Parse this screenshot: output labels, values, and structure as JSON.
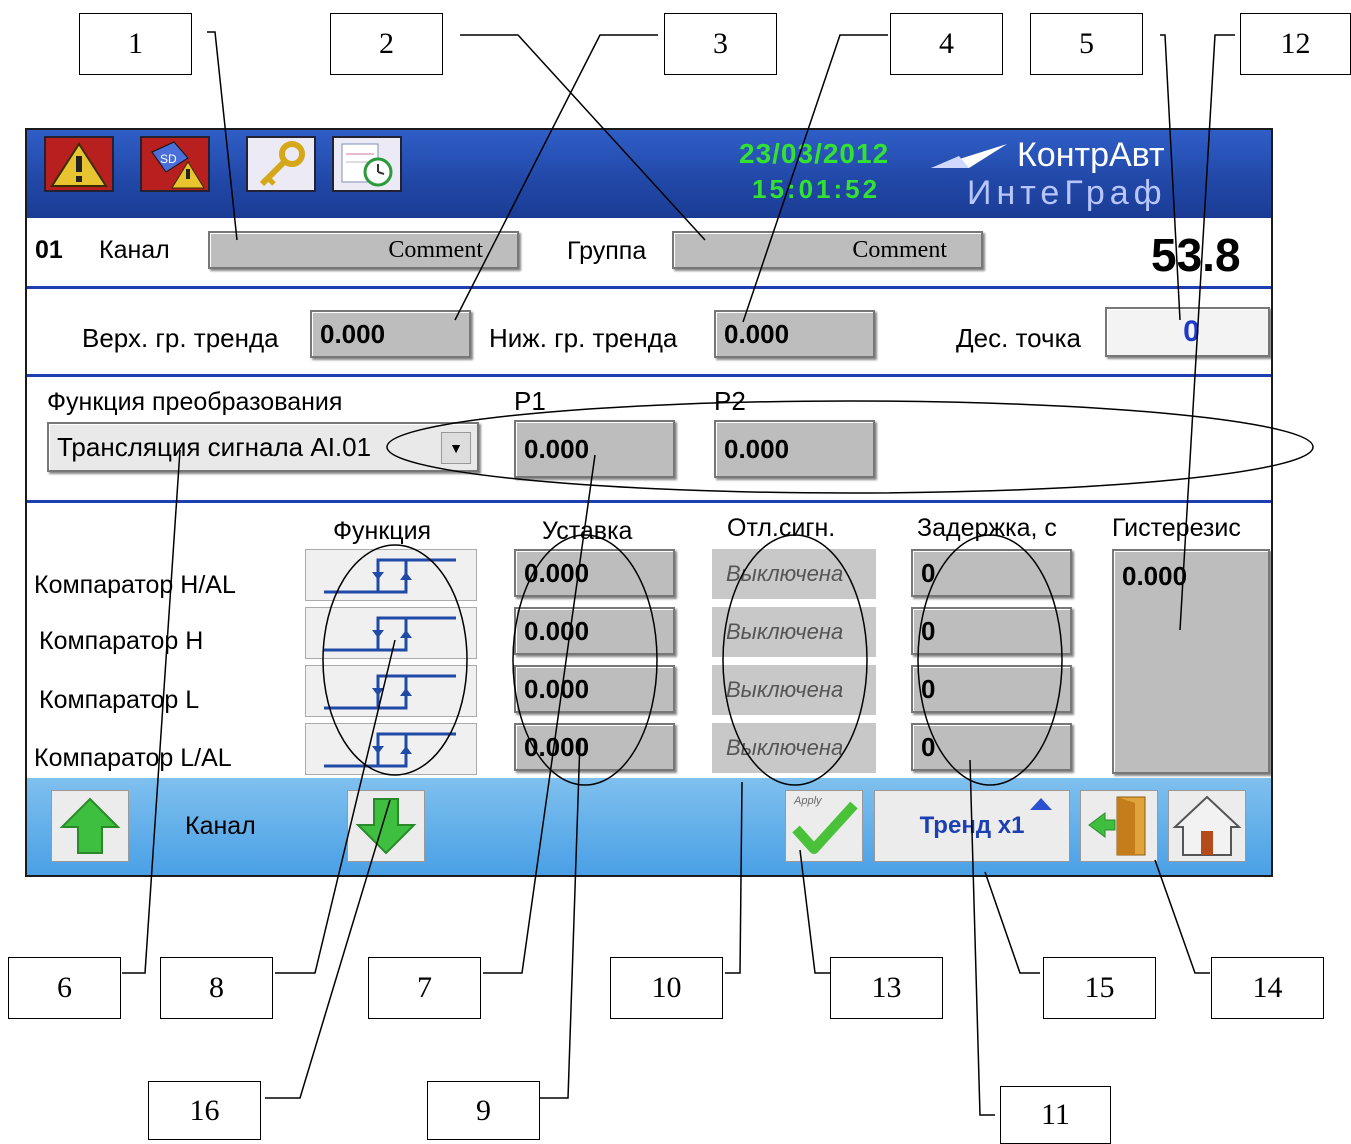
{
  "callouts": [
    "1",
    "2",
    "3",
    "4",
    "5",
    "12",
    "6",
    "8",
    "7",
    "10",
    "13",
    "15",
    "14",
    "16",
    "9",
    "11"
  ],
  "header": {
    "date": "23/03/2012",
    "time": "15:01:52",
    "brand_line1": "КонтрАвт",
    "brand_line2": "ИнтеГраф"
  },
  "channel_row": {
    "number": "01",
    "channel_label": "Канал",
    "channel_comment": "Comment",
    "group_label": "Группа",
    "group_comment": "Comment",
    "value": "53.8"
  },
  "trend_row": {
    "upper_label": "Верх. гр. тренда",
    "upper_value": "0.000",
    "lower_label": "Ниж. гр. тренда",
    "lower_value": "0.000",
    "decimal_label": "Дес. точка",
    "decimal_value": "0"
  },
  "transform": {
    "label": "Функция преобразования",
    "selected": "Трансляция сигнала  AI.01",
    "p1_label": "P1",
    "p1_value": "0.000",
    "p2_label": "P2",
    "p2_value": "0.000"
  },
  "comparators": {
    "headers": {
      "function": "Функция",
      "setpoint": "Уставка",
      "alarm": "Отл.сигн.",
      "delay": "Задержка, с",
      "hysteresis": "Гистерезис"
    },
    "hysteresis_value": "0.000",
    "rows": [
      {
        "name": "Компаратор H/AL",
        "setpoint": "0.000",
        "alarm": "Выключена",
        "delay": "0"
      },
      {
        "name": "Компаратор H",
        "setpoint": "0.000",
        "alarm": "Выключена",
        "delay": "0"
      },
      {
        "name": "Компаратор L",
        "setpoint": "0.000",
        "alarm": "Выключена",
        "delay": "0"
      },
      {
        "name": "Компаратор L/AL",
        "setpoint": "0.000",
        "alarm": "Выключена",
        "delay": "0"
      }
    ]
  },
  "footer": {
    "channel_label": "Канал",
    "apply_label": "Apply",
    "trend_label": "Тренд x1"
  },
  "colors": {
    "topbar": "#2147a6",
    "accent_green": "#33e133",
    "divider": "#1d3fb1",
    "bottombar": "#4aa0e6"
  }
}
